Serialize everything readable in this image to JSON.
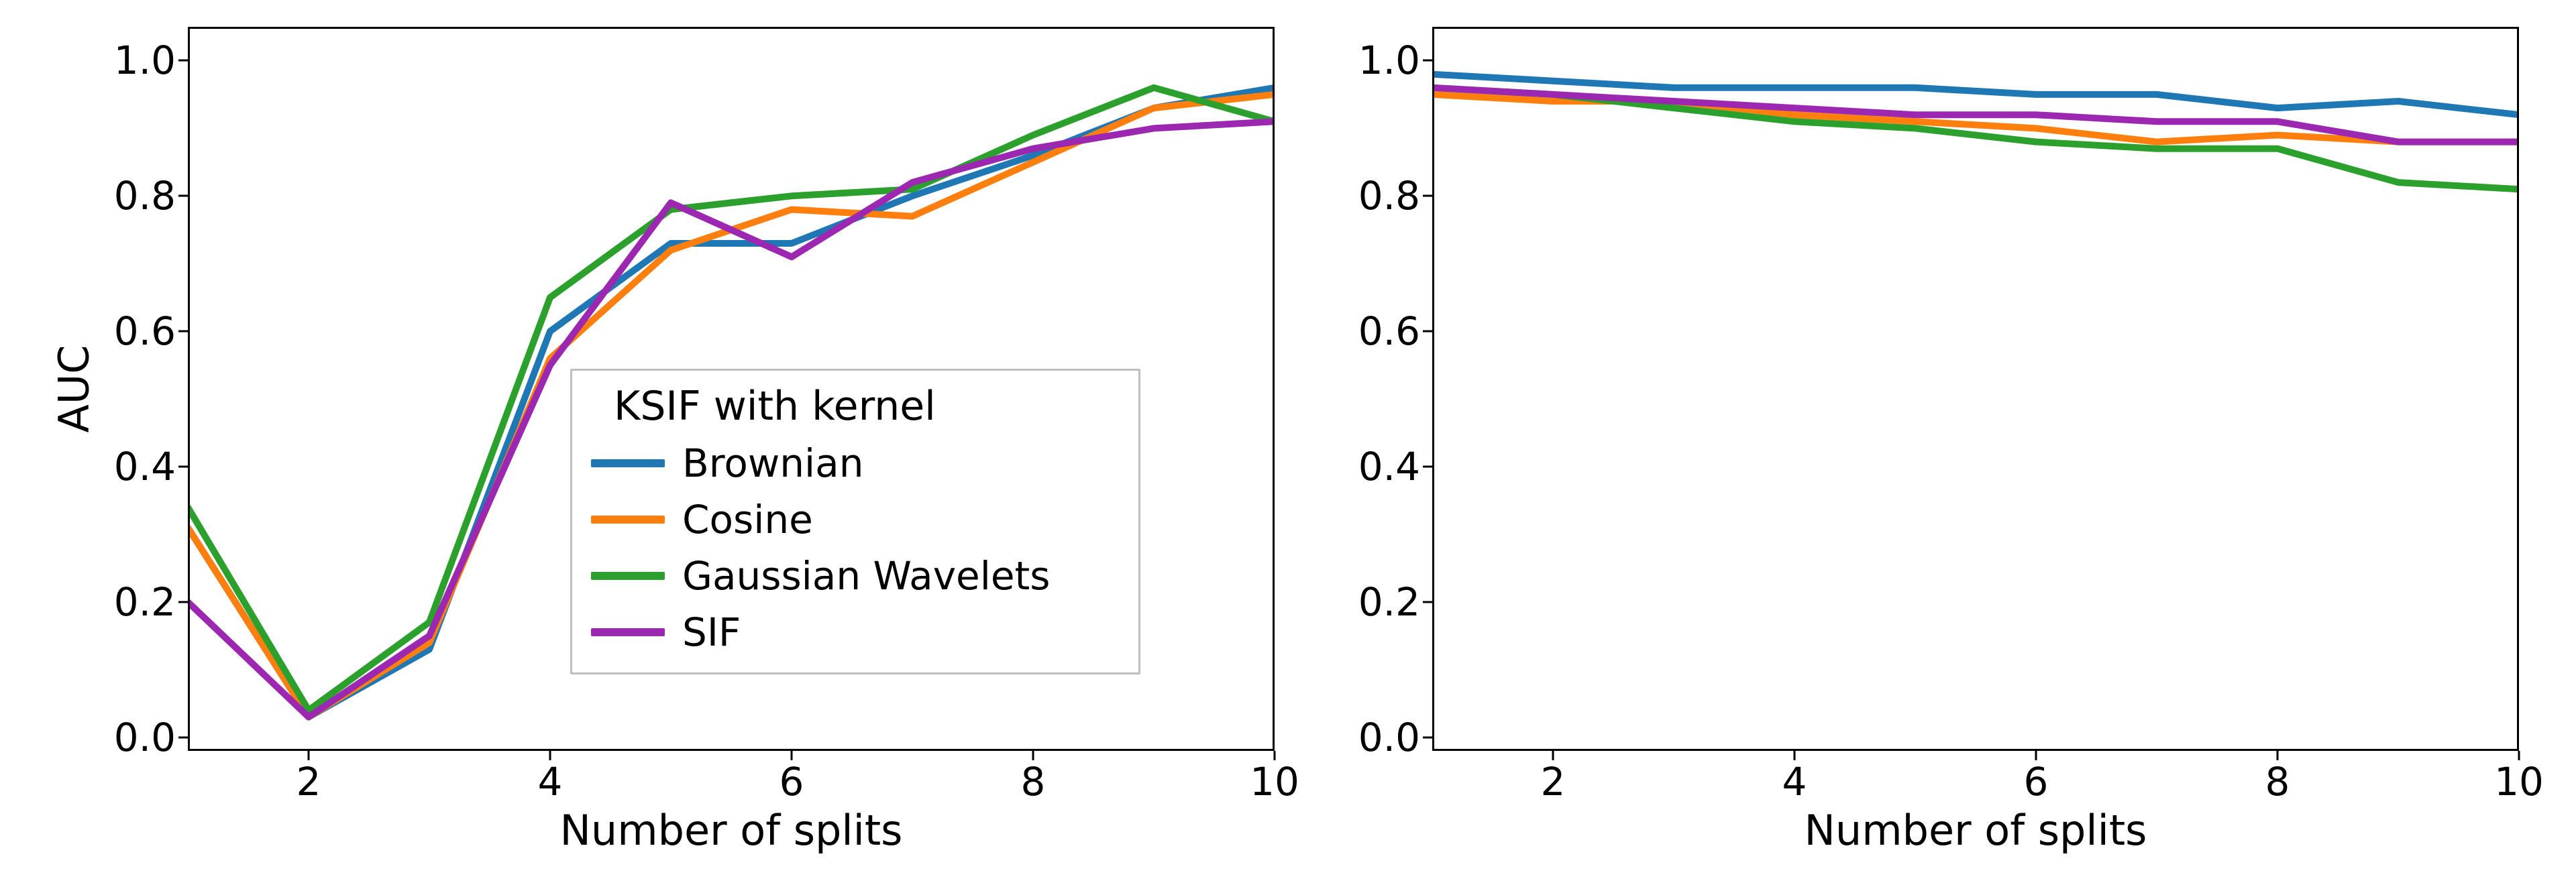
{
  "chart_data": [
    {
      "type": "line",
      "title": "",
      "xlabel": "Number of splits",
      "ylabel": "AUC",
      "xlim": [
        1,
        10
      ],
      "ylim": [
        -0.02,
        1.05
      ],
      "x_ticks": [
        2,
        4,
        6,
        8,
        10
      ],
      "y_ticks": [
        0.0,
        0.2,
        0.4,
        0.6,
        0.8,
        1.0
      ],
      "x": [
        1,
        2,
        3,
        4,
        5,
        6,
        7,
        8,
        9,
        10
      ],
      "series": [
        {
          "name": "Brownian",
          "color": "#1f77b4",
          "values": [
            0.31,
            0.03,
            0.13,
            0.6,
            0.73,
            0.73,
            0.8,
            0.86,
            0.93,
            0.96
          ]
        },
        {
          "name": "Cosine",
          "color": "#ff7f0e",
          "values": [
            0.31,
            0.03,
            0.14,
            0.56,
            0.72,
            0.78,
            0.77,
            0.85,
            0.93,
            0.95
          ]
        },
        {
          "name": "Gaussian Wavelets",
          "color": "#2ca02c",
          "values": [
            0.34,
            0.04,
            0.17,
            0.65,
            0.78,
            0.8,
            0.81,
            0.89,
            0.96,
            0.91
          ]
        },
        {
          "name": "SIF",
          "color": "#9c27b0",
          "values": [
            0.2,
            0.03,
            0.15,
            0.55,
            0.79,
            0.71,
            0.82,
            0.87,
            0.9,
            0.91
          ]
        }
      ],
      "legend": {
        "title": "KSIF with kernel",
        "items": [
          "Brownian",
          "Cosine",
          "Gaussian Wavelets",
          "SIF"
        ]
      }
    },
    {
      "type": "line",
      "title": "",
      "xlabel": "Number of splits",
      "ylabel": "",
      "xlim": [
        1,
        10
      ],
      "ylim": [
        -0.02,
        1.05
      ],
      "x_ticks": [
        2,
        4,
        6,
        8,
        10
      ],
      "y_ticks": [
        0.0,
        0.2,
        0.4,
        0.6,
        0.8,
        1.0
      ],
      "x": [
        1,
        2,
        3,
        4,
        5,
        6,
        7,
        8,
        9,
        10
      ],
      "series": [
        {
          "name": "Brownian",
          "color": "#1f77b4",
          "values": [
            0.98,
            0.97,
            0.96,
            0.96,
            0.96,
            0.95,
            0.95,
            0.93,
            0.94,
            0.92
          ]
        },
        {
          "name": "Cosine",
          "color": "#ff7f0e",
          "values": [
            0.95,
            0.94,
            0.94,
            0.92,
            0.91,
            0.9,
            0.88,
            0.89,
            0.88,
            0.88
          ]
        },
        {
          "name": "Gaussian Wavelets",
          "color": "#2ca02c",
          "values": [
            0.96,
            0.95,
            0.93,
            0.91,
            0.9,
            0.88,
            0.87,
            0.87,
            0.82,
            0.81
          ]
        },
        {
          "name": "SIF",
          "color": "#9c27b0",
          "values": [
            0.96,
            0.95,
            0.94,
            0.93,
            0.92,
            0.92,
            0.91,
            0.91,
            0.88,
            0.88
          ]
        }
      ]
    }
  ],
  "labels": {
    "xlabel": "Number of splits",
    "ylabel": "AUC",
    "legend_title": "KSIF with kernel",
    "legend_items": [
      "Brownian",
      "Cosine",
      "Gaussian Wavelets",
      "SIF"
    ],
    "xtick_labels": [
      "2",
      "4",
      "6",
      "8",
      "10"
    ],
    "ytick_labels": [
      "0.0",
      "0.2",
      "0.4",
      "0.6",
      "0.8",
      "1.0"
    ]
  },
  "colors": {
    "Brownian": "#1f77b4",
    "Cosine": "#ff7f0e",
    "Gaussian Wavelets": "#2ca02c",
    "SIF": "#9c27b0"
  }
}
